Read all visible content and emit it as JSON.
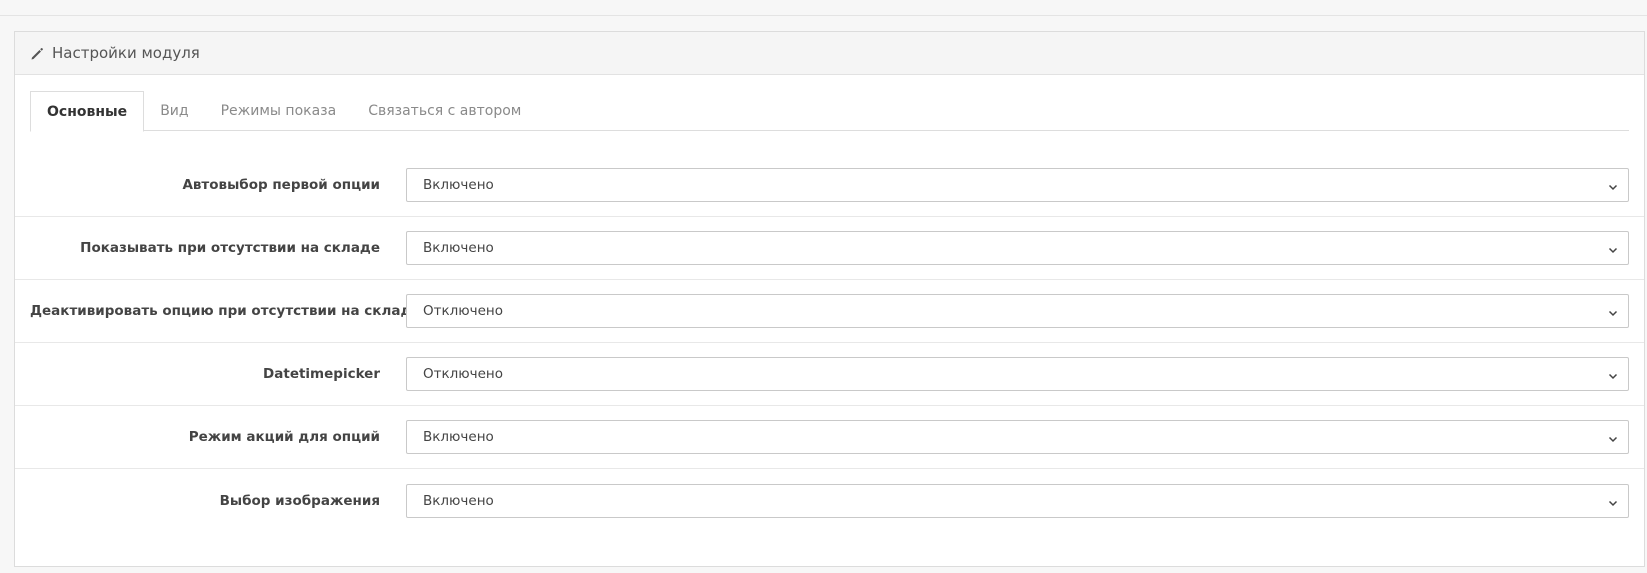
{
  "panel": {
    "title": "Настройки модуля"
  },
  "tabs": [
    {
      "label": "Основные",
      "active": true
    },
    {
      "label": "Вид",
      "active": false
    },
    {
      "label": "Режимы показа",
      "active": false
    },
    {
      "label": "Связаться с автором",
      "active": false
    }
  ],
  "settings": [
    {
      "label": "Автовыбор первой опции",
      "value": "Включено"
    },
    {
      "label": "Показывать при отсутствии на складе",
      "value": "Включено"
    },
    {
      "label": "Деактивировать опцию при отсутствии на складе",
      "value": "Отключено"
    },
    {
      "label": "Datetimepicker",
      "value": "Отключено"
    },
    {
      "label": "Режим акций для опций",
      "value": "Включено"
    },
    {
      "label": "Выбор изображения",
      "value": "Включено"
    }
  ],
  "icons": {
    "heading": "pencil-icon",
    "select": "chevron-down-icon"
  }
}
